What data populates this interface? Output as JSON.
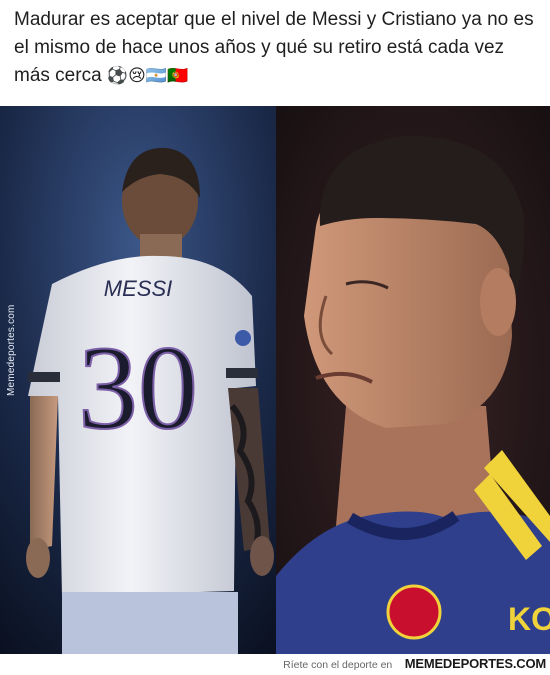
{
  "caption": {
    "text": "Madurar es aceptar que el nivel de Messi y Cristiano ya no es el mismo de hace unos años y qué su retiro está cada vez más cerca",
    "emojis": "⚽😢🇦🇷🇵🇹"
  },
  "photo": {
    "left": {
      "jersey_name": "MESSI",
      "jersey_number": "30",
      "watermark": "Memedeportes.com"
    },
    "right": {
      "sponsor_partial": "KO"
    }
  },
  "footer": {
    "tagline": "Ríete con el deporte en",
    "brand": "MEMEDEPORTES.COM"
  },
  "colors": {
    "left_bg": "#1b2a4a",
    "right_bg": "#1c1416",
    "jersey_white": "#eeeff3",
    "utd_blue": "#2f3f8c",
    "utd_yellow": "#f0d23a"
  }
}
